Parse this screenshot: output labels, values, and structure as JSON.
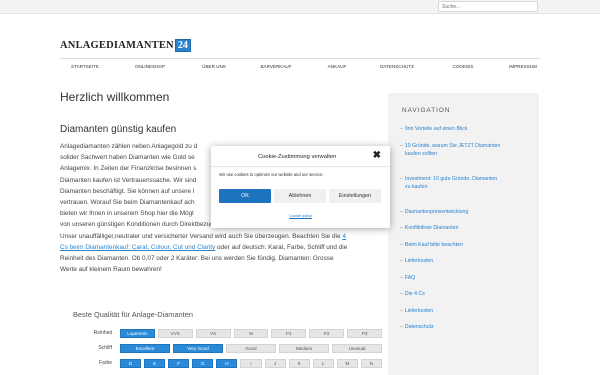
{
  "search": {
    "placeholder": "Suche..."
  },
  "logo": {
    "main": "ANLAGEDIAMANTEN",
    "number": "24"
  },
  "nav": [
    "STARTSEITE",
    "ONLINESHOP",
    "ÜBER UNS",
    "BARVERKAUF",
    "ANKAUF",
    "DATENSCHUTZ",
    "COOKIES",
    "IMPRESSUM"
  ],
  "main": {
    "title": "Herzlich willkommen",
    "subtitle": "Diamanten günstig kaufen",
    "para_lines": [
      "Anlagediamanten zählen neben Anlagegold zu d",
      "solider Sachwert haben Diamanten wie Gold se",
      "Anlagemix. In Zeiten der Finanzkrise besinnen s",
      "Diamanten kaufen ist Vertrauenssache. Wir sind",
      "Diamanten beschäftigt. Sie können auf unsere l",
      "vertrauen. Worauf Sie beim Diamantenkauf ach",
      "bieten wir Ihnen in unserem Shop hier die Mögl",
      "von unseren günstigen Konditionen durch Direktbezug und der einwandfreien, zertifizierten Ware.",
      "Unser unauffälliger,neutraler und versicherter Versand wird auch Sie überzeugen. Beachten Sie die",
      "oder auf deutsch: Karat, Farbe, Schliff und die",
      "Reinheit des Diamanten. Ob 0,07 oder 2 Karäter: Bei uns werden Sie fündig. Diamanten: Grosse",
      "Werte auf kleinem Raum bewahren!"
    ],
    "link_4": "4",
    "link_4cs": "Cs beim Diamantenkauf: Carat, Colour, Cut und Clarity"
  },
  "quality": {
    "title": "Beste Qualität für Anlage-Diamanten",
    "rows": [
      {
        "label": "Reinheit",
        "options": [
          "Lupenrein",
          "VVS",
          "VS",
          "SI",
          "P1",
          "P2",
          "P3"
        ],
        "active": [
          0
        ]
      },
      {
        "label": "Schliff",
        "options": [
          "Excellent",
          "Very Good",
          "Good",
          "Medium",
          "Unusual"
        ],
        "active": [
          0,
          1
        ]
      },
      {
        "label": "Farbe",
        "options": [
          "D",
          "E",
          "F",
          "G",
          "H",
          "I",
          "J",
          "K",
          "L",
          "M",
          "N"
        ],
        "active": [
          0,
          1,
          2,
          3,
          4
        ]
      }
    ]
  },
  "sidebar": {
    "title": "NAVIGATION",
    "items": [
      [
        "9nn Vorteile auf einen Blick"
      ],
      [
        "10 Gründe, warum Sie JETZT Diamanten",
        "kaufen sollten"
      ],
      [
        "Investment: 10 gute Gründe, Diamanten",
        "zu kaufen"
      ],
      [
        "Diamantenpreisentwicklung"
      ],
      [
        "Konfliktfreie Diamanten"
      ],
      [
        "Beim Kauf bitte beachten"
      ],
      [
        "Lieferkosten"
      ],
      [
        "FAQ"
      ],
      [
        "Die 4 Cs"
      ],
      [
        "Lieferkosten"
      ],
      [
        "Datenschutz"
      ]
    ]
  },
  "cookie": {
    "title": "Cookie-Zustimmung verwalten",
    "close": "✖",
    "text": "Wir use cookies to optimize our website and our service.",
    "accept": "OK",
    "deny": "Ablehnen",
    "settings": "Einstellungen",
    "policy": "Cookie policy",
    "accent": "#1e73be"
  }
}
